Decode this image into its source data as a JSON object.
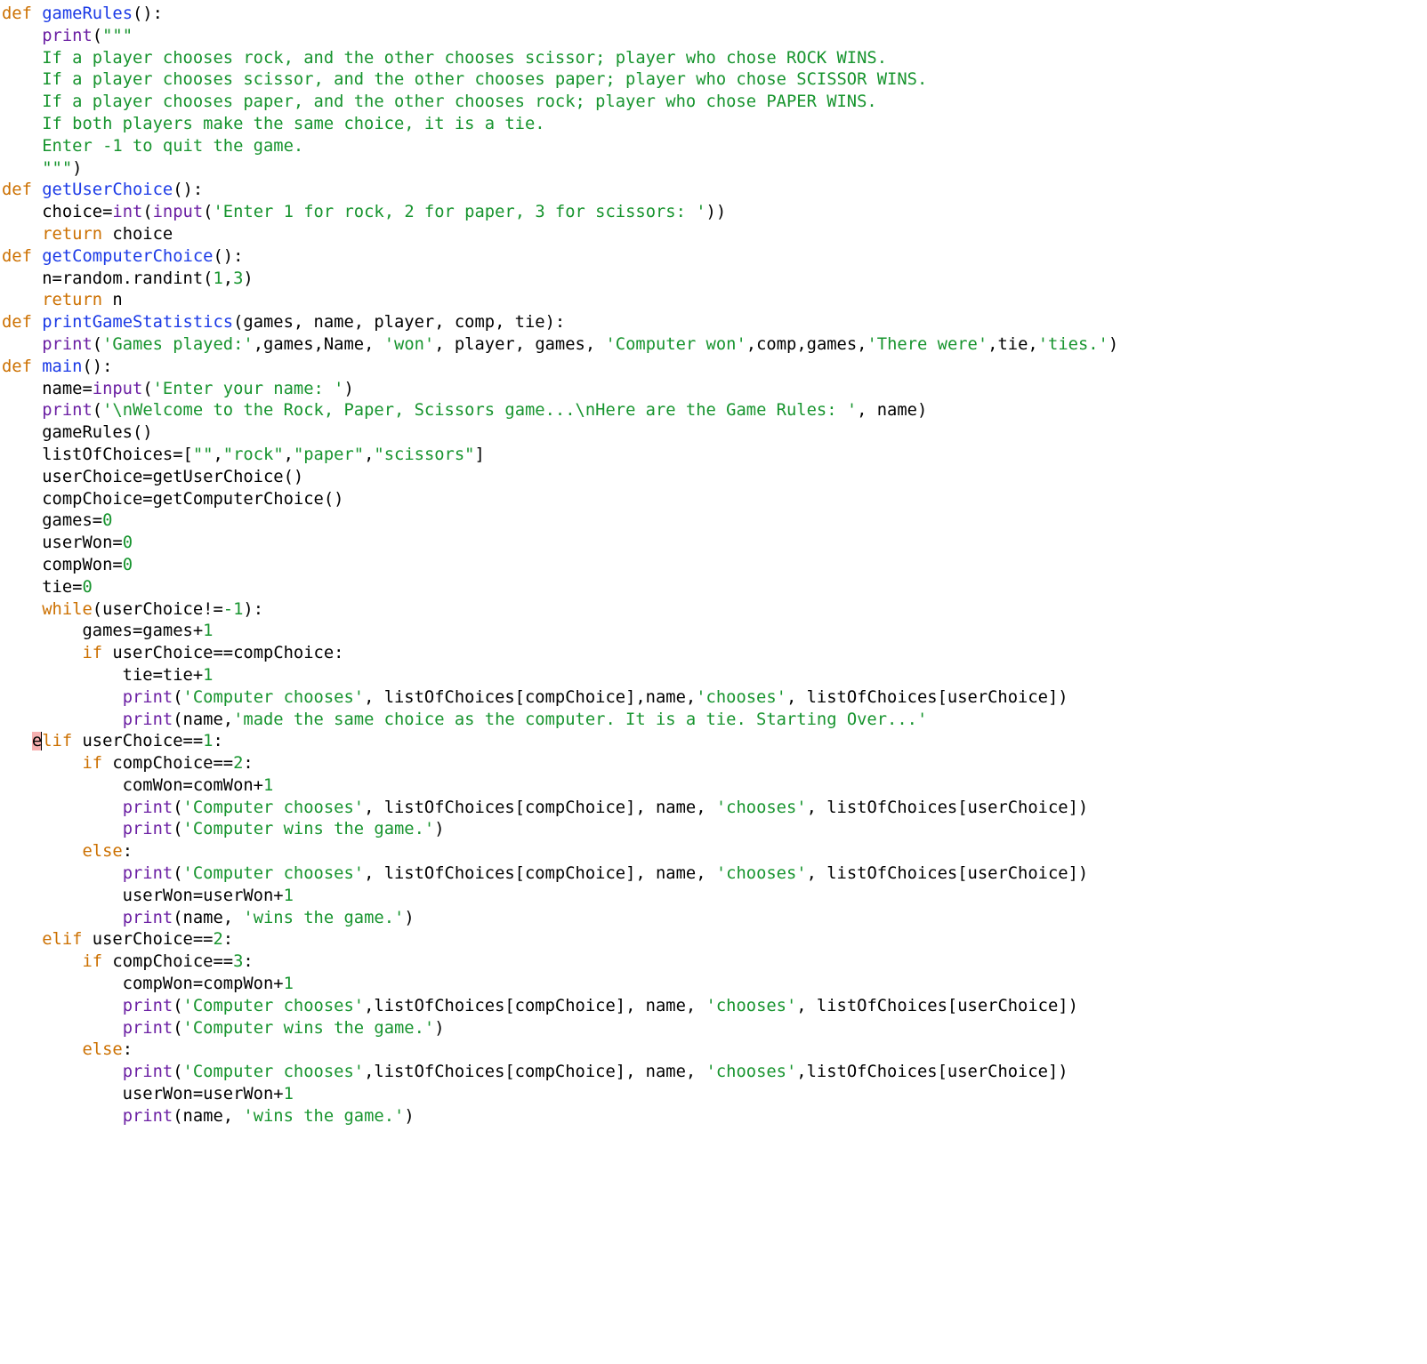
{
  "tokens": [
    {
      "cls": "kw",
      "t": "def "
    },
    {
      "cls": "fn",
      "t": "gameRules"
    },
    {
      "t": "():\n"
    },
    {
      "t": "    "
    },
    {
      "cls": "call",
      "t": "print"
    },
    {
      "t": "("
    },
    {
      "cls": "str",
      "t": "\"\"\""
    },
    {
      "t": "\n"
    },
    {
      "cls": "str",
      "t": "    If a player chooses rock, and the other chooses scissor; player who chose ROCK WINS."
    },
    {
      "t": "\n"
    },
    {
      "cls": "str",
      "t": "    If a player chooses scissor, and the other chooses paper; player who chose SCISSOR WINS."
    },
    {
      "t": "\n"
    },
    {
      "cls": "str",
      "t": "    If a player chooses paper, and the other chooses rock; player who chose PAPER WINS."
    },
    {
      "t": "\n"
    },
    {
      "cls": "str",
      "t": "    If both players make the same choice, it is a tie."
    },
    {
      "t": "\n"
    },
    {
      "cls": "str",
      "t": "    Enter -1 to quit the game."
    },
    {
      "t": "\n"
    },
    {
      "cls": "str",
      "t": "    \"\"\""
    },
    {
      "t": ")\n"
    },
    {
      "cls": "kw",
      "t": "def "
    },
    {
      "cls": "fn",
      "t": "getUserChoice"
    },
    {
      "t": "():\n"
    },
    {
      "t": "    choice="
    },
    {
      "cls": "call",
      "t": "int"
    },
    {
      "t": "("
    },
    {
      "cls": "call",
      "t": "input"
    },
    {
      "t": "("
    },
    {
      "cls": "str",
      "t": "'Enter 1 for rock, 2 for paper, 3 for scissors: '"
    },
    {
      "t": "))\n"
    },
    {
      "t": "    "
    },
    {
      "cls": "kw",
      "t": "return"
    },
    {
      "t": " choice\n"
    },
    {
      "cls": "kw",
      "t": "def "
    },
    {
      "cls": "fn",
      "t": "getComputerChoice"
    },
    {
      "t": "():\n"
    },
    {
      "t": "    n=random.randint("
    },
    {
      "cls": "num",
      "t": "1"
    },
    {
      "t": ","
    },
    {
      "cls": "num",
      "t": "3"
    },
    {
      "t": ")\n"
    },
    {
      "t": "    "
    },
    {
      "cls": "kw",
      "t": "return"
    },
    {
      "t": " n\n"
    },
    {
      "cls": "kw",
      "t": "def "
    },
    {
      "cls": "fn",
      "t": "printGameStatistics"
    },
    {
      "t": "(games, name, player, comp, tie):\n"
    },
    {
      "t": "    "
    },
    {
      "cls": "call",
      "t": "print"
    },
    {
      "t": "("
    },
    {
      "cls": "str",
      "t": "'Games played:'"
    },
    {
      "t": ",games,Name, "
    },
    {
      "cls": "str",
      "t": "'won'"
    },
    {
      "t": ", player, games, "
    },
    {
      "cls": "str",
      "t": "'Computer won'"
    },
    {
      "t": ",comp,games,"
    },
    {
      "cls": "str",
      "t": "'There were'"
    },
    {
      "t": ",tie,"
    },
    {
      "cls": "str",
      "t": "'ties.'"
    },
    {
      "t": ")\n"
    },
    {
      "cls": "kw",
      "t": "def "
    },
    {
      "cls": "fn",
      "t": "main"
    },
    {
      "t": "():\n"
    },
    {
      "t": "    name="
    },
    {
      "cls": "call",
      "t": "input"
    },
    {
      "t": "("
    },
    {
      "cls": "str",
      "t": "'Enter your name: '"
    },
    {
      "t": ")\n"
    },
    {
      "t": "    "
    },
    {
      "cls": "call",
      "t": "print"
    },
    {
      "t": "("
    },
    {
      "cls": "str",
      "t": "'\\nWelcome to the Rock, Paper, Scissors game...\\nHere are the Game Rules: '"
    },
    {
      "t": ", name)\n"
    },
    {
      "t": "    gameRules()\n"
    },
    {
      "t": "    listOfChoices=["
    },
    {
      "cls": "str",
      "t": "\"\""
    },
    {
      "t": ","
    },
    {
      "cls": "str",
      "t": "\"rock\""
    },
    {
      "t": ","
    },
    {
      "cls": "str",
      "t": "\"paper\""
    },
    {
      "t": ","
    },
    {
      "cls": "str",
      "t": "\"scissors\""
    },
    {
      "t": "]\n"
    },
    {
      "t": "    userChoice=getUserChoice()\n"
    },
    {
      "t": "    compChoice=getComputerChoice()\n"
    },
    {
      "t": "    games="
    },
    {
      "cls": "num",
      "t": "0"
    },
    {
      "t": "\n"
    },
    {
      "t": "    userWon="
    },
    {
      "cls": "num",
      "t": "0"
    },
    {
      "t": "\n"
    },
    {
      "t": "    compWon="
    },
    {
      "cls": "num",
      "t": "0"
    },
    {
      "t": "\n"
    },
    {
      "t": "    tie="
    },
    {
      "cls": "num",
      "t": "0"
    },
    {
      "t": "\n"
    },
    {
      "t": "    "
    },
    {
      "cls": "kw",
      "t": "while"
    },
    {
      "t": "(userChoice!="
    },
    {
      "cls": "num",
      "t": "-1"
    },
    {
      "t": "):\n"
    },
    {
      "t": "        games=games+"
    },
    {
      "cls": "num",
      "t": "1"
    },
    {
      "t": "\n"
    },
    {
      "t": "        "
    },
    {
      "cls": "kw",
      "t": "if"
    },
    {
      "t": " userChoice==compChoice:\n"
    },
    {
      "t": "            tie=tie+"
    },
    {
      "cls": "num",
      "t": "1"
    },
    {
      "t": "\n"
    },
    {
      "t": "            "
    },
    {
      "cls": "call",
      "t": "print"
    },
    {
      "t": "("
    },
    {
      "cls": "str",
      "t": "'Computer chooses'"
    },
    {
      "t": ", listOfChoices[compChoice],name,"
    },
    {
      "cls": "str",
      "t": "'chooses'"
    },
    {
      "t": ", listOfChoices[userChoice])\n"
    },
    {
      "t": "            "
    },
    {
      "cls": "call",
      "t": "print"
    },
    {
      "t": "(name,"
    },
    {
      "cls": "str",
      "t": "'made the same choice as the computer. It is a tie. Starting Over...'"
    },
    {
      "t": "\n"
    },
    {
      "t": "   "
    },
    {
      "cls": "err",
      "t": "e"
    },
    {
      "cls": "cursor",
      "t": ""
    },
    {
      "cls": "kw",
      "t": "lif"
    },
    {
      "t": " userChoice=="
    },
    {
      "cls": "num",
      "t": "1"
    },
    {
      "t": ":\n"
    },
    {
      "t": "        "
    },
    {
      "cls": "kw",
      "t": "if"
    },
    {
      "t": " compChoice=="
    },
    {
      "cls": "num",
      "t": "2"
    },
    {
      "t": ":\n"
    },
    {
      "t": "            comWon=comWon+"
    },
    {
      "cls": "num",
      "t": "1"
    },
    {
      "t": "\n"
    },
    {
      "t": "            "
    },
    {
      "cls": "call",
      "t": "print"
    },
    {
      "t": "("
    },
    {
      "cls": "str",
      "t": "'Computer chooses'"
    },
    {
      "t": ", listOfChoices[compChoice], name, "
    },
    {
      "cls": "str",
      "t": "'chooses'"
    },
    {
      "t": ", listOfChoices[userChoice])\n"
    },
    {
      "t": "            "
    },
    {
      "cls": "call",
      "t": "print"
    },
    {
      "t": "("
    },
    {
      "cls": "str",
      "t": "'Computer wins the game.'"
    },
    {
      "t": ")\n"
    },
    {
      "t": "        "
    },
    {
      "cls": "kw",
      "t": "else"
    },
    {
      "t": ":\n"
    },
    {
      "t": "            "
    },
    {
      "cls": "call",
      "t": "print"
    },
    {
      "t": "("
    },
    {
      "cls": "str",
      "t": "'Computer chooses'"
    },
    {
      "t": ", listOfChoices[compChoice], name, "
    },
    {
      "cls": "str",
      "t": "'chooses'"
    },
    {
      "t": ", listOfChoices[userChoice])\n"
    },
    {
      "t": "            userWon=userWon+"
    },
    {
      "cls": "num",
      "t": "1"
    },
    {
      "t": "\n"
    },
    {
      "t": "            "
    },
    {
      "cls": "call",
      "t": "print"
    },
    {
      "t": "(name, "
    },
    {
      "cls": "str",
      "t": "'wins the game.'"
    },
    {
      "t": ")\n"
    },
    {
      "t": "    "
    },
    {
      "cls": "kw",
      "t": "elif"
    },
    {
      "t": " userChoice=="
    },
    {
      "cls": "num",
      "t": "2"
    },
    {
      "t": ":\n"
    },
    {
      "t": "        "
    },
    {
      "cls": "kw",
      "t": "if"
    },
    {
      "t": " compChoice=="
    },
    {
      "cls": "num",
      "t": "3"
    },
    {
      "t": ":\n"
    },
    {
      "t": "            compWon=compWon+"
    },
    {
      "cls": "num",
      "t": "1"
    },
    {
      "t": "\n"
    },
    {
      "t": "            "
    },
    {
      "cls": "call",
      "t": "print"
    },
    {
      "t": "("
    },
    {
      "cls": "str",
      "t": "'Computer chooses'"
    },
    {
      "t": ",listOfChoices[compChoice], name, "
    },
    {
      "cls": "str",
      "t": "'chooses'"
    },
    {
      "t": ", listOfChoices[userChoice])\n"
    },
    {
      "t": "            "
    },
    {
      "cls": "call",
      "t": "print"
    },
    {
      "t": "("
    },
    {
      "cls": "str",
      "t": "'Computer wins the game.'"
    },
    {
      "t": ")\n"
    },
    {
      "t": "        "
    },
    {
      "cls": "kw",
      "t": "else"
    },
    {
      "t": ":\n"
    },
    {
      "t": "            "
    },
    {
      "cls": "call",
      "t": "print"
    },
    {
      "t": "("
    },
    {
      "cls": "str",
      "t": "'Computer chooses'"
    },
    {
      "t": ",listOfChoices[compChoice], name, "
    },
    {
      "cls": "str",
      "t": "'chooses'"
    },
    {
      "t": ",listOfChoices[userChoice])\n"
    },
    {
      "t": "            userWon=userWon+"
    },
    {
      "cls": "num",
      "t": "1"
    },
    {
      "t": "\n"
    },
    {
      "t": "            "
    },
    {
      "cls": "call",
      "t": "print"
    },
    {
      "t": "(name, "
    },
    {
      "cls": "str",
      "t": "'wins the game.'"
    },
    {
      "t": ")\n"
    }
  ]
}
